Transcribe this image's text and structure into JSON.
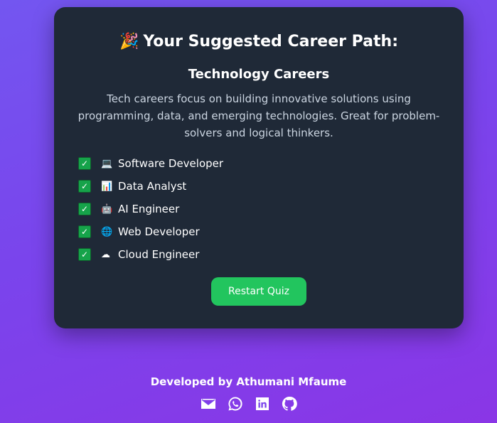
{
  "result": {
    "title_emoji": "🎉",
    "title": "Your Suggested Career Path:",
    "category": "Technology Careers",
    "description": "Tech careers focus on building innovative solutions using programming, data, and emerging technologies. Great for problem-solvers and logical thinkers.",
    "careers": [
      {
        "icon": "💻",
        "label": "Software Developer"
      },
      {
        "icon": "📊",
        "label": "Data Analyst"
      },
      {
        "icon": "🤖",
        "label": "AI Engineer"
      },
      {
        "icon": "🌐",
        "label": "Web Developer"
      },
      {
        "icon": "☁",
        "label": "Cloud Engineer"
      }
    ],
    "check_glyph": "✓",
    "restart_label": "Restart Quiz"
  },
  "footer": {
    "credit": "Developed by Athumani Mfaume",
    "social_icons": [
      "email-icon",
      "whatsapp-icon",
      "linkedin-icon",
      "github-icon"
    ]
  },
  "colors": {
    "card": "#1f2937",
    "accent_green": "#22c55e",
    "checkbox_green": "#16a34a",
    "background_start": "#7356f0",
    "background_end": "#8a36e6"
  }
}
